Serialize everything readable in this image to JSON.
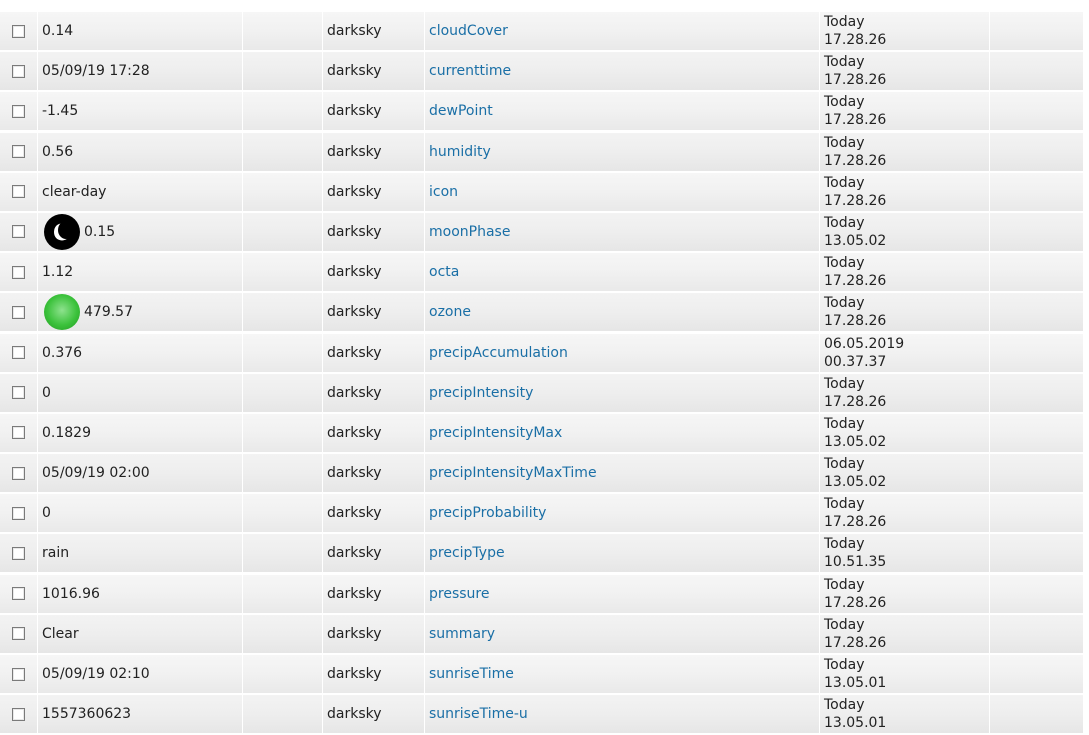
{
  "rows": [
    {
      "value": "0.14",
      "source": "darksky",
      "name": "cloudCover",
      "time_line1": "Today",
      "time_line2": "17.28.26",
      "icon": ""
    },
    {
      "value": "05/09/19 17:28",
      "source": "darksky",
      "name": "currenttime",
      "time_line1": "Today",
      "time_line2": "17.28.26",
      "icon": ""
    },
    {
      "value": "-1.45",
      "source": "darksky",
      "name": "dewPoint",
      "time_line1": "Today",
      "time_line2": "17.28.26",
      "icon": ""
    },
    {
      "value": "0.56",
      "source": "darksky",
      "name": "humidity",
      "time_line1": "Today",
      "time_line2": "17.28.26",
      "icon": ""
    },
    {
      "value": "clear-day",
      "source": "darksky",
      "name": "icon",
      "time_line1": "Today",
      "time_line2": "17.28.26",
      "icon": ""
    },
    {
      "value": "0.15",
      "source": "darksky",
      "name": "moonPhase",
      "time_line1": "Today",
      "time_line2": "13.05.02",
      "icon": "moon-icon"
    },
    {
      "value": "1.12",
      "source": "darksky",
      "name": "octa",
      "time_line1": "Today",
      "time_line2": "17.28.26",
      "icon": ""
    },
    {
      "value": "479.57",
      "source": "darksky",
      "name": "ozone",
      "time_line1": "Today",
      "time_line2": "17.28.26",
      "icon": "ozone-indicator-icon"
    },
    {
      "value": "0.376",
      "source": "darksky",
      "name": "precipAccumulation",
      "time_line1": "06.05.2019",
      "time_line2": "00.37.37",
      "icon": ""
    },
    {
      "value": "0",
      "source": "darksky",
      "name": "precipIntensity",
      "time_line1": "Today",
      "time_line2": "17.28.26",
      "icon": ""
    },
    {
      "value": "0.1829",
      "source": "darksky",
      "name": "precipIntensityMax",
      "time_line1": "Today",
      "time_line2": "13.05.02",
      "icon": ""
    },
    {
      "value": "05/09/19 02:00",
      "source": "darksky",
      "name": "precipIntensityMaxTime",
      "time_line1": "Today",
      "time_line2": "13.05.02",
      "icon": ""
    },
    {
      "value": "0",
      "source": "darksky",
      "name": "precipProbability",
      "time_line1": "Today",
      "time_line2": "17.28.26",
      "icon": ""
    },
    {
      "value": "rain",
      "source": "darksky",
      "name": "precipType",
      "time_line1": "Today",
      "time_line2": "10.51.35",
      "icon": ""
    },
    {
      "value": "1016.96",
      "source": "darksky",
      "name": "pressure",
      "time_line1": "Today",
      "time_line2": "17.28.26",
      "icon": ""
    },
    {
      "value": "Clear",
      "source": "darksky",
      "name": "summary",
      "time_line1": "Today",
      "time_line2": "17.28.26",
      "icon": ""
    },
    {
      "value": "05/09/19 02:10",
      "source": "darksky",
      "name": "sunriseTime",
      "time_line1": "Today",
      "time_line2": "13.05.01",
      "icon": ""
    },
    {
      "value": "1557360623",
      "source": "darksky",
      "name": "sunriseTime-u",
      "time_line1": "Today",
      "time_line2": "13.05.01",
      "icon": ""
    }
  ],
  "colors": {
    "link": "#1a6fa6",
    "ozone_indicator": "#3cc23c",
    "moon_icon": "#000000"
  }
}
